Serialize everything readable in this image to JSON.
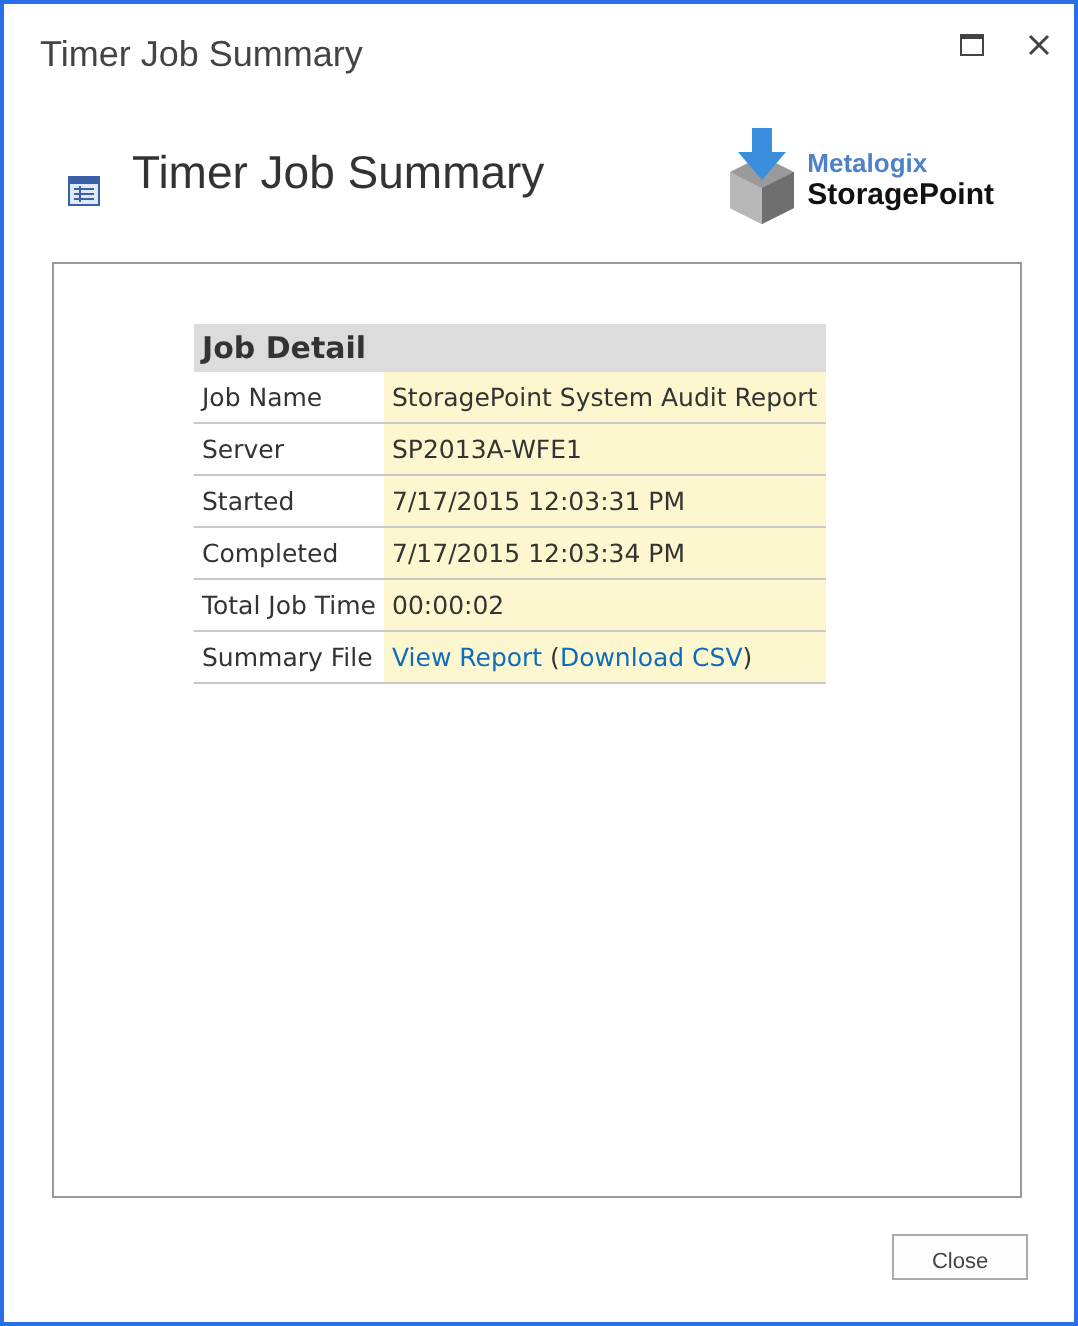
{
  "window": {
    "title": "Timer Job Summary"
  },
  "header": {
    "title": "Timer Job Summary",
    "logo": {
      "brand": "Metalogix",
      "product": "StoragePoint"
    }
  },
  "table": {
    "heading": "Job Detail",
    "rows": [
      {
        "label": "Job Name",
        "parts": [
          {
            "kind": "text",
            "text": "StoragePoint System Audit Report"
          }
        ]
      },
      {
        "label": "Server",
        "parts": [
          {
            "kind": "text",
            "text": "SP2013A-WFE1"
          }
        ]
      },
      {
        "label": "Started",
        "parts": [
          {
            "kind": "text",
            "text": "7/17/2015 12:03:31 PM"
          }
        ]
      },
      {
        "label": "Completed",
        "parts": [
          {
            "kind": "text",
            "text": "7/17/2015 12:03:34 PM"
          }
        ]
      },
      {
        "label": "Total Job Time",
        "parts": [
          {
            "kind": "text",
            "text": "00:00:02"
          }
        ]
      },
      {
        "label": "Summary File",
        "parts": [
          {
            "kind": "link",
            "text": "View Report"
          },
          {
            "kind": "text",
            "text": " ("
          },
          {
            "kind": "link",
            "text": "Download CSV"
          },
          {
            "kind": "text",
            "text": ")"
          }
        ]
      }
    ]
  },
  "buttons": [
    "Close"
  ]
}
